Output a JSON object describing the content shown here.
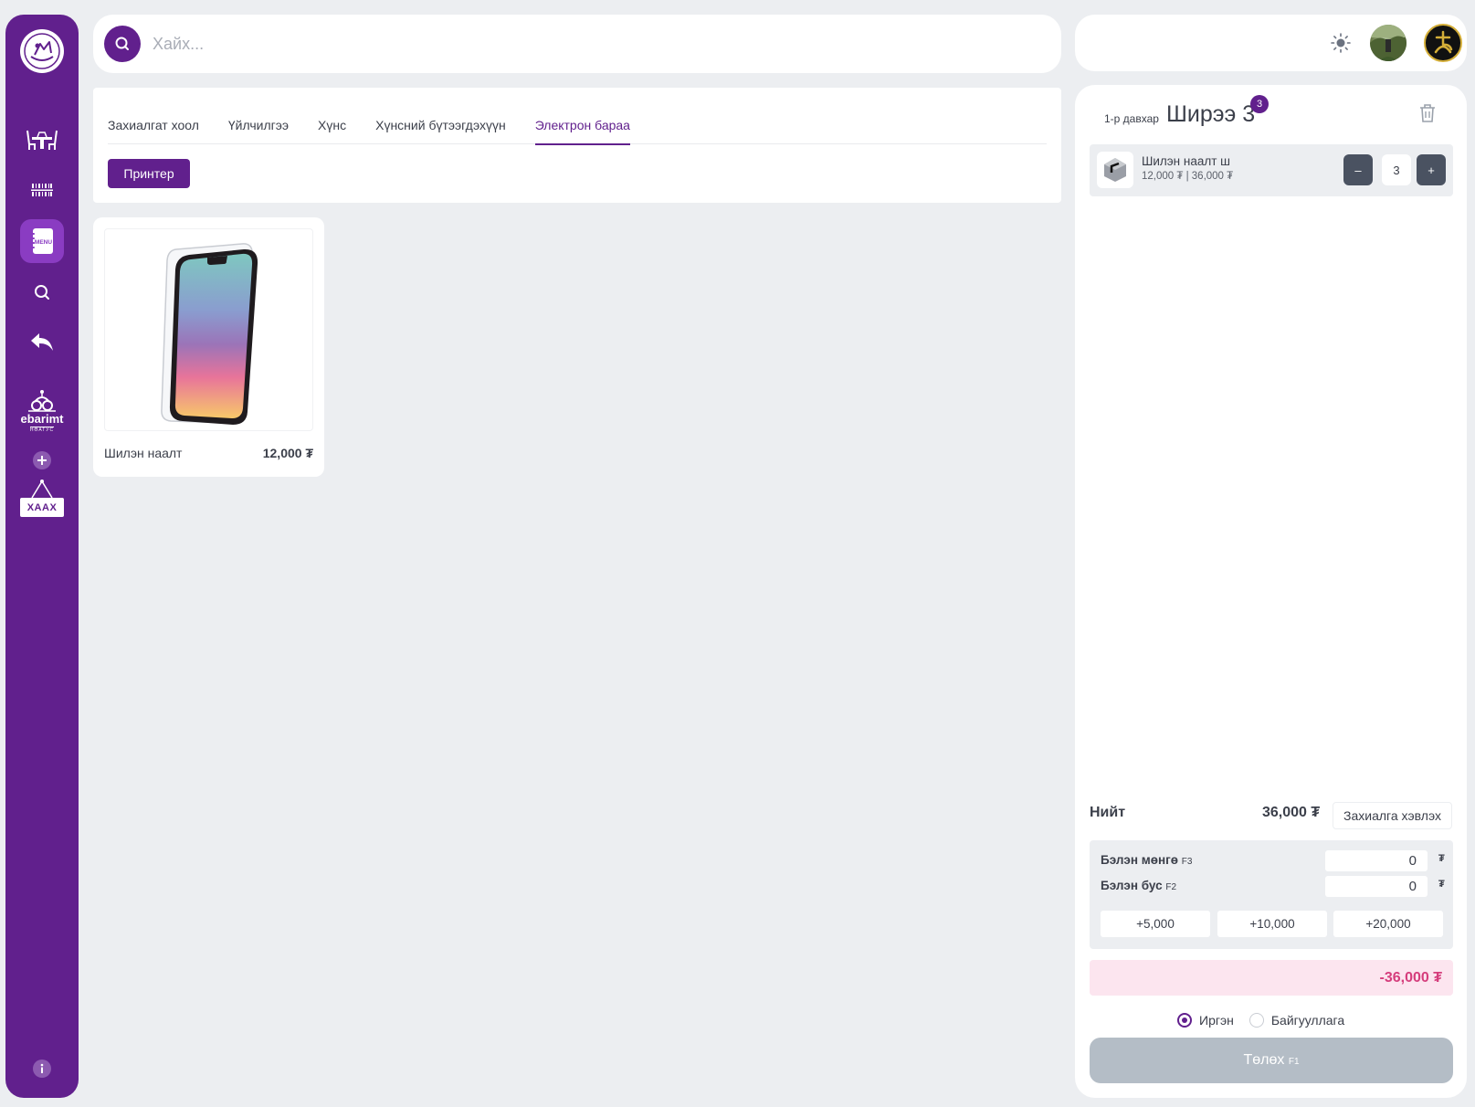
{
  "sidebar": {
    "items": [
      {
        "icon": "dining-table-icon"
      },
      {
        "icon": "barcode-icon"
      },
      {
        "icon": "menu-book-icon",
        "label": "MENU",
        "active": true
      },
      {
        "icon": "search-icon"
      },
      {
        "icon": "reply-icon"
      },
      {
        "icon": "ebarimt-icon",
        "label": "ebarimt",
        "sublabel": "НӨАТУС"
      },
      {
        "icon": "add-circle-icon"
      },
      {
        "icon": "close-sign-icon",
        "label": "ХААХ"
      },
      {
        "icon": "info-icon"
      }
    ]
  },
  "search": {
    "placeholder": "Хайх..."
  },
  "categories": {
    "tabs": [
      {
        "label": "Захиалгат хоол",
        "active": false
      },
      {
        "label": "Үйлчилгээ",
        "active": false
      },
      {
        "label": "Хүнс",
        "active": false
      },
      {
        "label": "Хүнсний бүтээгдэхүүн",
        "active": false
      },
      {
        "label": "Электрон бараа",
        "active": true
      }
    ],
    "filter_button": "Принтер"
  },
  "products": [
    {
      "name": "Шилэн наалт",
      "price": "12,000 ₮"
    }
  ],
  "order": {
    "floor": "1-р давхар",
    "table": "Ширээ 3",
    "badge": "3",
    "items": [
      {
        "name": "Шилэн наалт ш",
        "detail": "12,000 ₮ | 36,000 ₮",
        "quantity": "3",
        "minus": "–",
        "plus": "+"
      }
    ],
    "total_label": "Нийт",
    "total_value": "36,000 ₮",
    "print_order_label": "Захиалга хэвлэх",
    "payment": {
      "cash_label": "Бэлэн мөнгө",
      "cash_key": "F3",
      "cash_value": "0",
      "noncash_label": "Бэлэн бус",
      "noncash_key": "F2",
      "noncash_value": "0",
      "currency": "₮",
      "quick_amounts": [
        "+5,000",
        "+10,000",
        "+20,000"
      ]
    },
    "balance": "-36,000 ₮",
    "customer_type": {
      "options": [
        "Иргэн",
        "Байгууллага"
      ],
      "selected": "Иргэн"
    },
    "pay_button": "Төлөх",
    "pay_key": "F1"
  },
  "colors": {
    "brand": "#61208d",
    "background": "#eceef1",
    "balance_text": "#d53d7c",
    "balance_bg": "#fce5ef",
    "pay_button_disabled": "#b4bdc6"
  }
}
